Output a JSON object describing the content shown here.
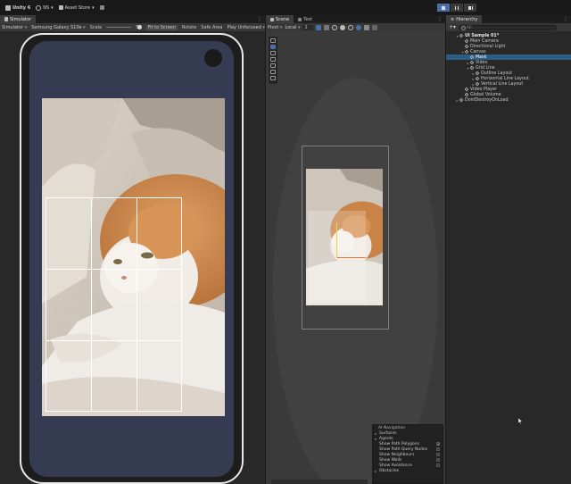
{
  "toolbar": {
    "app_title": "Unity 6",
    "account": "NS",
    "asset_store": "Asset Store"
  },
  "simulator": {
    "tab": "Simulator",
    "mode": "Simulator",
    "device": "Samsung Galaxy S10e",
    "scale_label": "Scale",
    "scale_value": "53",
    "fit_label": "Fit to Screen",
    "rotate_label": "Rotate",
    "safe_area_label": "Safe Area",
    "play_mode": "Play Unfocused"
  },
  "scene": {
    "tab": "Scene",
    "game_tab": "Test",
    "pivot": "Pivot",
    "space": "Local",
    "snap_value": "1"
  },
  "ai_navigation": {
    "title": "AI Navigation",
    "surfaces": "Surfaces",
    "agents": "Agents",
    "options": [
      {
        "label": "Show Path Polygons",
        "checked": true,
        "mark": "✓"
      },
      {
        "label": "Show Path Query Nodes",
        "checked": false,
        "mark": ""
      },
      {
        "label": "Show Neighbours",
        "checked": false,
        "mark": ""
      },
      {
        "label": "Show Walls",
        "checked": false,
        "mark": ""
      },
      {
        "label": "Show Avoidance",
        "checked": false,
        "mark": ""
      }
    ],
    "obstacles": "Obstacles"
  },
  "hierarchy": {
    "tab": "Hierarchy",
    "search_placeholder": "All",
    "items": [
      {
        "label": "UI Sample 01*",
        "depth": 0,
        "arrow": "▾",
        "bold": true
      },
      {
        "label": "Main Camera",
        "depth": 1,
        "arrow": ""
      },
      {
        "label": "Directional Light",
        "depth": 1,
        "arrow": ""
      },
      {
        "label": "Canvas",
        "depth": 1,
        "arrow": "▾"
      },
      {
        "label": "Mask",
        "depth": 2,
        "arrow": "",
        "selected": true
      },
      {
        "label": "Video",
        "depth": 2,
        "arrow": "▸"
      },
      {
        "label": "Grid Line",
        "depth": 2,
        "arrow": "▾"
      },
      {
        "label": "Outline Layout",
        "depth": 3,
        "arrow": "▸"
      },
      {
        "label": "Horizontal Line Layout",
        "depth": 3,
        "arrow": "▸"
      },
      {
        "label": "Vertical Line Layout",
        "depth": 3,
        "arrow": "▸"
      },
      {
        "label": "Video Player",
        "depth": 1,
        "arrow": ""
      },
      {
        "label": "Global Volume",
        "depth": 1,
        "arrow": ""
      },
      {
        "label": "DontDestroyOnLoad",
        "depth": 0,
        "arrow": "▸"
      }
    ]
  }
}
